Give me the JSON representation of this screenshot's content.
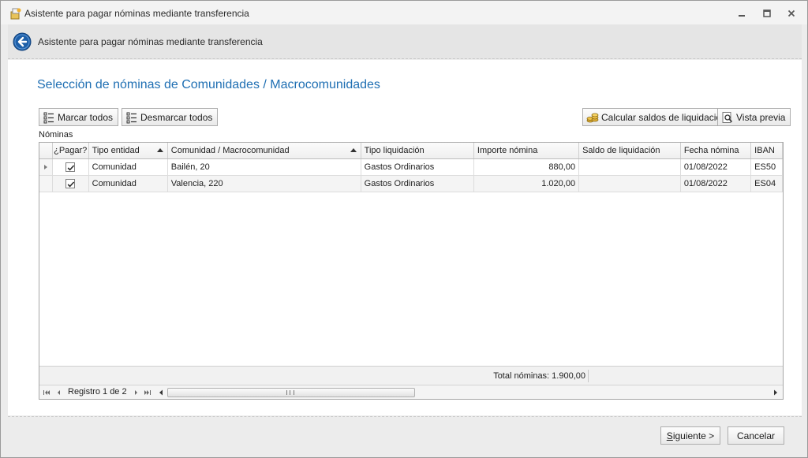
{
  "window": {
    "title": "Asistente para pagar nóminas mediante transferencia",
    "icon": "wizard-app-icon"
  },
  "header": {
    "title": "Asistente para pagar nóminas mediante transferencia",
    "back_icon": "back-arrow-icon"
  },
  "main": {
    "section_title": "Selección de nóminas de Comunidades / Macrocomunidades",
    "buttons": {
      "mark_all": "Marcar todos",
      "unmark_all": "Desmarcar todos",
      "calc_balances": "Calcular saldos de liquidación",
      "preview": "Vista previa"
    },
    "grid_label": "Nóminas",
    "grid": {
      "columns": [
        "¿Pagar?",
        "Tipo entidad",
        "Comunidad / Macrocomunidad",
        "Tipo liquidación",
        "Importe nómina",
        "Saldo de liquidación",
        "Fecha nómina",
        "IBAN"
      ],
      "rows": [
        {
          "pay": true,
          "entity_type": "Comunidad",
          "community": "Bailén, 20",
          "liquidation_type": "Gastos Ordinarios",
          "amount": "880,00",
          "balance": "",
          "date": "01/08/2022",
          "iban": "ES50"
        },
        {
          "pay": true,
          "entity_type": "Comunidad",
          "community": "Valencia, 220",
          "liquidation_type": "Gastos Ordinarios",
          "amount": "1.020,00",
          "balance": "",
          "date": "01/08/2022",
          "iban": "ES04"
        }
      ],
      "total": "Total nóminas: 1.900,00",
      "navigator": {
        "record_text": "Registro 1 de 2"
      }
    }
  },
  "footer": {
    "next_prefix": "S",
    "next_rest": "iguiente >",
    "cancel": "Cancelar"
  },
  "colors": {
    "accent_title": "#1f6fb3",
    "back_icon": "#1d5fa8"
  }
}
